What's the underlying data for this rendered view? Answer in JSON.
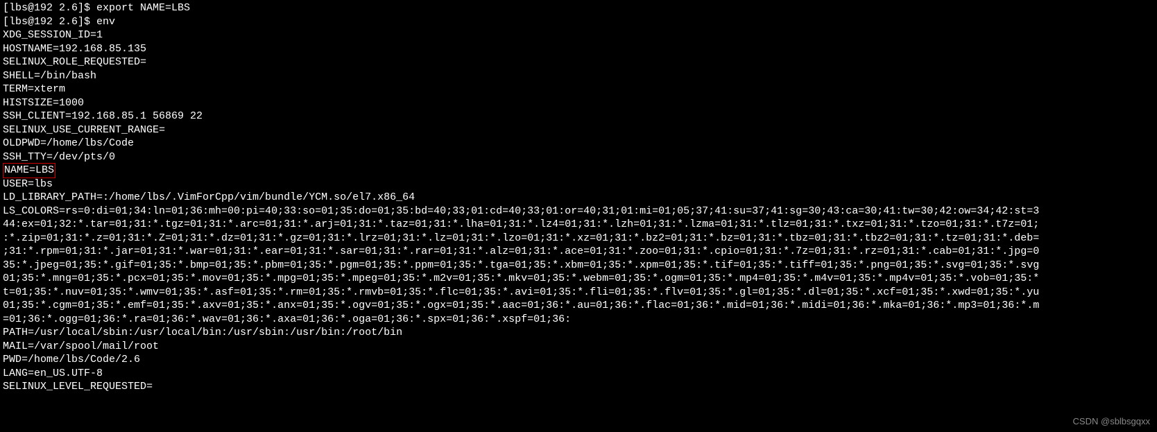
{
  "terminal": {
    "prompt1": "[lbs@192 2.6]$ ",
    "cmd1": "export NAME=LBS",
    "prompt2": "[lbs@192 2.6]$ ",
    "cmd2": "env",
    "env_lines": [
      "XDG_SESSION_ID=1",
      "HOSTNAME=192.168.85.135",
      "SELINUX_ROLE_REQUESTED=",
      "SHELL=/bin/bash",
      "TERM=xterm",
      "HISTSIZE=1000",
      "SSH_CLIENT=192.168.85.1 56869 22",
      "SELINUX_USE_CURRENT_RANGE=",
      "OLDPWD=/home/lbs/Code",
      "SSH_TTY=/dev/pts/0"
    ],
    "highlighted_line": "NAME=LBS",
    "env_lines_after": [
      "USER=lbs",
      "LD_LIBRARY_PATH=:/home/lbs/.VimForCpp/vim/bundle/YCM.so/el7.x86_64",
      "LS_COLORS=rs=0:di=01;34:ln=01;36:mh=00:pi=40;33:so=01;35:do=01;35:bd=40;33;01:cd=40;33;01:or=40;31;01:mi=01;05;37;41:su=37;41:sg=30;43:ca=30;41:tw=30;42:ow=34;42:st=3",
      "44:ex=01;32:*.tar=01;31:*.tgz=01;31:*.arc=01;31:*.arj=01;31:*.taz=01;31:*.lha=01;31:*.lz4=01;31:*.lzh=01;31:*.lzma=01;31:*.tlz=01;31:*.txz=01;31:*.tzo=01;31:*.t7z=01;",
      ":*.zip=01;31:*.z=01;31:*.Z=01;31:*.dz=01;31:*.gz=01;31:*.lrz=01;31:*.lz=01;31:*.lzo=01;31:*.xz=01;31:*.bz2=01;31:*.bz=01;31:*.tbz=01;31:*.tbz2=01;31:*.tz=01;31:*.deb=",
      ";31:*.rpm=01;31:*.jar=01;31:*.war=01;31:*.ear=01;31:*.sar=01;31:*.rar=01;31:*.alz=01;31:*.ace=01;31:*.zoo=01;31:*.cpio=01;31:*.7z=01;31:*.rz=01;31:*.cab=01;31:*.jpg=0",
      "35:*.jpeg=01;35:*.gif=01;35:*.bmp=01;35:*.pbm=01;35:*.pgm=01;35:*.ppm=01;35:*.tga=01;35:*.xbm=01;35:*.xpm=01;35:*.tif=01;35:*.tiff=01;35:*.png=01;35:*.svg=01;35:*.svg",
      "01;35:*.mng=01;35:*.pcx=01;35:*.mov=01;35:*.mpg=01;35:*.mpeg=01;35:*.m2v=01;35:*.mkv=01;35:*.webm=01;35:*.ogm=01;35:*.mp4=01;35:*.m4v=01;35:*.mp4v=01;35:*.vob=01;35:*",
      "t=01;35:*.nuv=01;35:*.wmv=01;35:*.asf=01;35:*.rm=01;35:*.rmvb=01;35:*.flc=01;35:*.avi=01;35:*.fli=01;35:*.flv=01;35:*.gl=01;35:*.dl=01;35:*.xcf=01;35:*.xwd=01;35:*.yu",
      "01;35:*.cgm=01;35:*.emf=01;35:*.axv=01;35:*.anx=01;35:*.ogv=01;35:*.ogx=01;35:*.aac=01;36:*.au=01;36:*.flac=01;36:*.mid=01;36:*.midi=01;36:*.mka=01;36:*.mp3=01;36:*.m",
      "=01;36:*.ogg=01;36:*.ra=01;36:*.wav=01;36:*.axa=01;36:*.oga=01;36:*.spx=01;36:*.xspf=01;36:",
      "PATH=/usr/local/sbin:/usr/local/bin:/usr/sbin:/usr/bin:/root/bin",
      "MAIL=/var/spool/mail/root",
      "PWD=/home/lbs/Code/2.6",
      "LANG=en_US.UTF-8",
      "SELINUX_LEVEL_REQUESTED="
    ]
  },
  "watermark": "CSDN @sblbsgqxx"
}
